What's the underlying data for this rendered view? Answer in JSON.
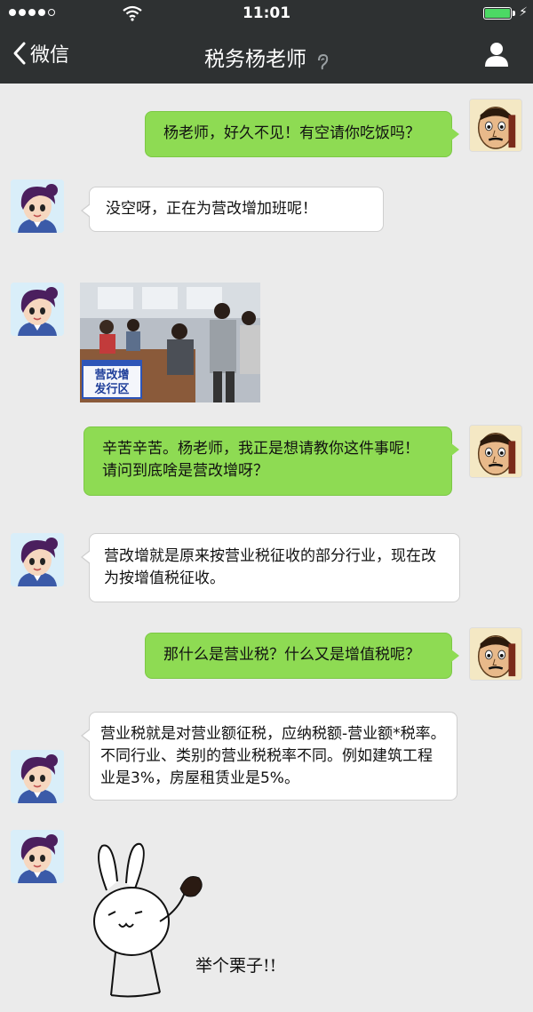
{
  "status_bar": {
    "time": "11:01",
    "battery_color": "#4cd964"
  },
  "nav": {
    "back_label": "微信",
    "title": "税务杨老师"
  },
  "messages": [
    {
      "side": "right",
      "text": "杨老师，好久不见！有空请你吃饭吗？"
    },
    {
      "side": "left",
      "text": "没空呀，正在为营改增加班呢！"
    },
    {
      "side": "left",
      "type": "image",
      "sign_line1": "营改增",
      "sign_line2": "发行区"
    },
    {
      "side": "right",
      "text": "辛苦辛苦。杨老师，我正是想请教你这件事呢！请问到底啥是营改增呀？"
    },
    {
      "side": "left",
      "text": "营改增就是原来按营业税征收的部分行业，现在改为按增值税征收。"
    },
    {
      "side": "right",
      "text": "那什么是营业税？什么又是增值税呢？"
    },
    {
      "side": "left",
      "text": "营业税就是对营业额征税，应纳税额-营业额*税率。不同行业、类别的营业税税率不同。例如建筑工程业是3%，房屋租赁业是5%。"
    },
    {
      "side": "left",
      "type": "sticker",
      "sticker_text": "举个栗子!!"
    }
  ],
  "colors": {
    "header": "#2e3132",
    "background": "#ebebeb",
    "bubble_sent": "#8edb53",
    "bubble_received": "#ffffff"
  },
  "icons": [
    "signal-dots-icon",
    "wifi-icon",
    "battery-icon",
    "back-chevron-icon",
    "ear-icon",
    "profile-icon"
  ]
}
